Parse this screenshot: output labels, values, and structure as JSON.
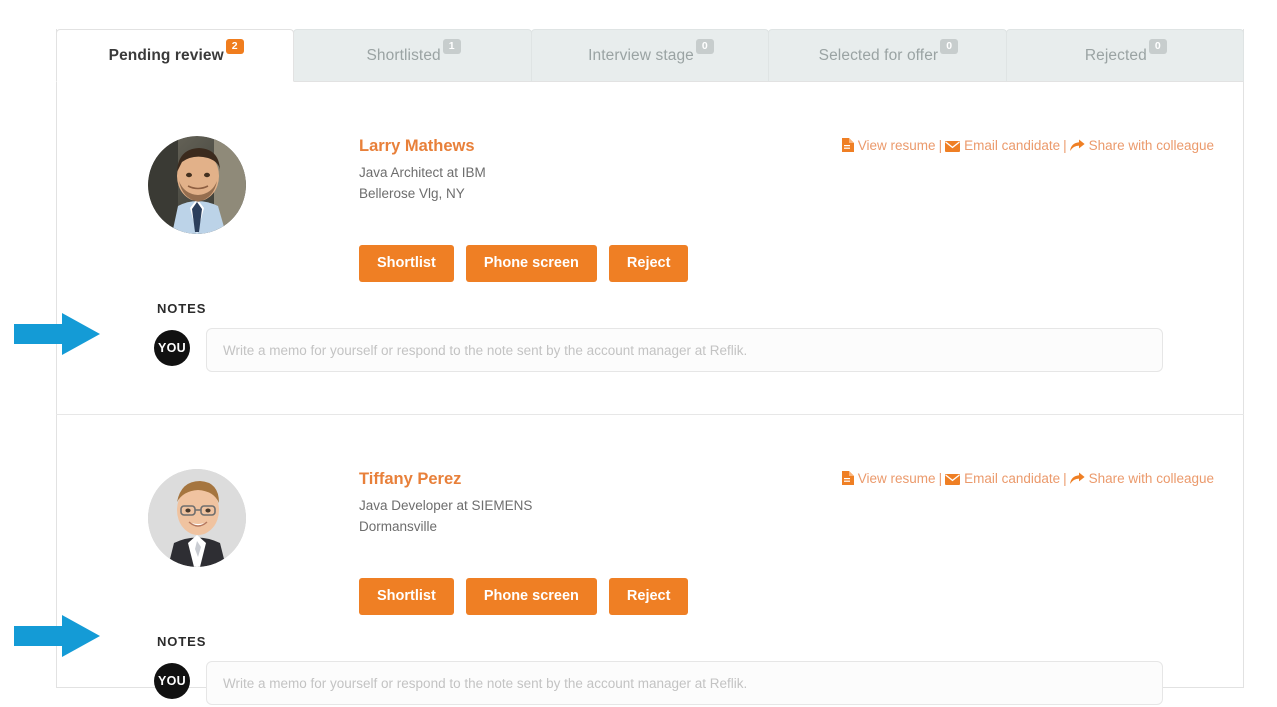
{
  "tabs": [
    {
      "label": "Pending review",
      "count": "2",
      "active": true
    },
    {
      "label": "Shortlisted",
      "count": "1",
      "active": false
    },
    {
      "label": "Interview stage",
      "count": "0",
      "active": false
    },
    {
      "label": "Selected for offer",
      "count": "0",
      "active": false
    },
    {
      "label": "Rejected",
      "count": "0",
      "active": false
    }
  ],
  "links": {
    "view_resume": "View resume",
    "email_candidate": "Email candidate",
    "share_with_colleague": "Share with colleague",
    "separator": "|",
    "icons": {
      "resume": "file-text-icon",
      "email": "envelope-icon",
      "share": "share-arrow-icon"
    }
  },
  "buttons": {
    "shortlist": "Shortlist",
    "phone_screen": "Phone screen",
    "reject": "Reject"
  },
  "notes": {
    "label": "NOTES",
    "author_avatar": "YOU",
    "placeholder": "Write a memo for yourself or respond to the note sent by the account manager at Reflik.",
    "value": ""
  },
  "candidates": [
    {
      "name": "Larry Mathews",
      "title": "Java Architect at IBM",
      "location": "Bellerose Vlg, NY",
      "avatar": "photo-bearded-man-blue-shirt"
    },
    {
      "name": "Tiffany Perez",
      "title": "Java Developer at SIEMENS",
      "location": "Dormansville",
      "avatar": "photo-man-glasses-dark-suit"
    }
  ],
  "annotations": {
    "arrow_color": "#149BD6",
    "arrow_target": "you-avatar"
  },
  "colors": {
    "accent_orange": "#ef7f24",
    "name_orange": "#e8803a",
    "link_orange": "#eb9a6c",
    "tab_inactive_bg": "#e8eded",
    "badge_gray": "#c7cdcd",
    "arrow_blue": "#149BD6"
  }
}
